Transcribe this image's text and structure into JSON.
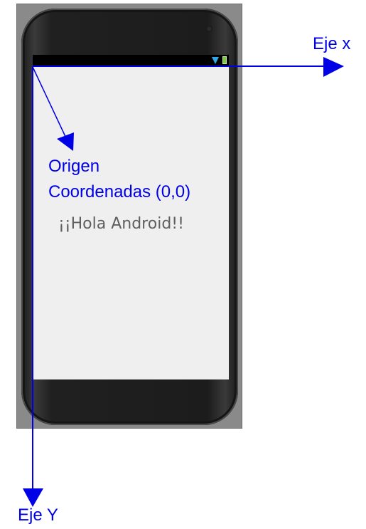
{
  "diagram": {
    "screen_text": "¡¡Hola Android!!",
    "origin_label_line1": "Origen",
    "origin_label_line2": "Coordenadas (0,0)",
    "x_axis_label": "Eje x",
    "y_axis_label": "Eje Y",
    "colors": {
      "annotation": "#0000e6",
      "screen": "#efefef",
      "phone": "#1c1c1c"
    },
    "icons": [
      "wifi-icon",
      "battery-icon"
    ]
  }
}
